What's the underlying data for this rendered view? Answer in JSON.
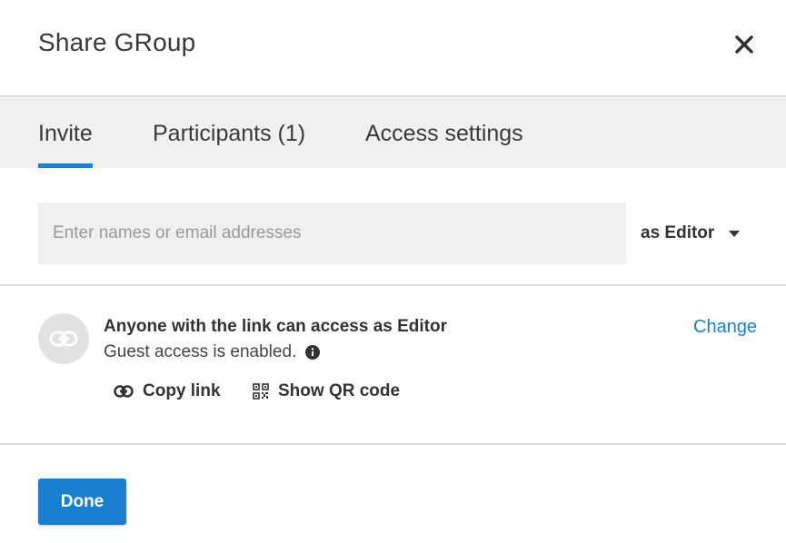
{
  "dialog": {
    "title": "Share GRoup",
    "close_icon": "close-icon"
  },
  "tabs": [
    {
      "label": "Invite",
      "active": true
    },
    {
      "label": "Participants (1)",
      "active": false
    },
    {
      "label": "Access settings",
      "active": false
    }
  ],
  "invite": {
    "placeholder": "Enter names or email addresses",
    "value": "",
    "role": "as Editor",
    "role_icon": "chevron-down-icon"
  },
  "link_access": {
    "icon": "link-icon",
    "heading": "Anyone with the link can access as Editor",
    "guest_text": "Guest access is enabled.",
    "guest_info_icon": "info-icon",
    "change_label": "Change",
    "copy_link_label": "Copy link",
    "copy_link_icon": "link-icon",
    "qr_label": "Show QR code",
    "qr_icon": "qr-code-icon"
  },
  "footer": {
    "done_label": "Done"
  },
  "colors": {
    "accent": "#1a7fcf",
    "tab_bar_bg": "#f0f0f0",
    "input_bg": "#f0f0f0",
    "divider": "#dcdcdc",
    "avatar_bg": "#e2e2e2"
  }
}
